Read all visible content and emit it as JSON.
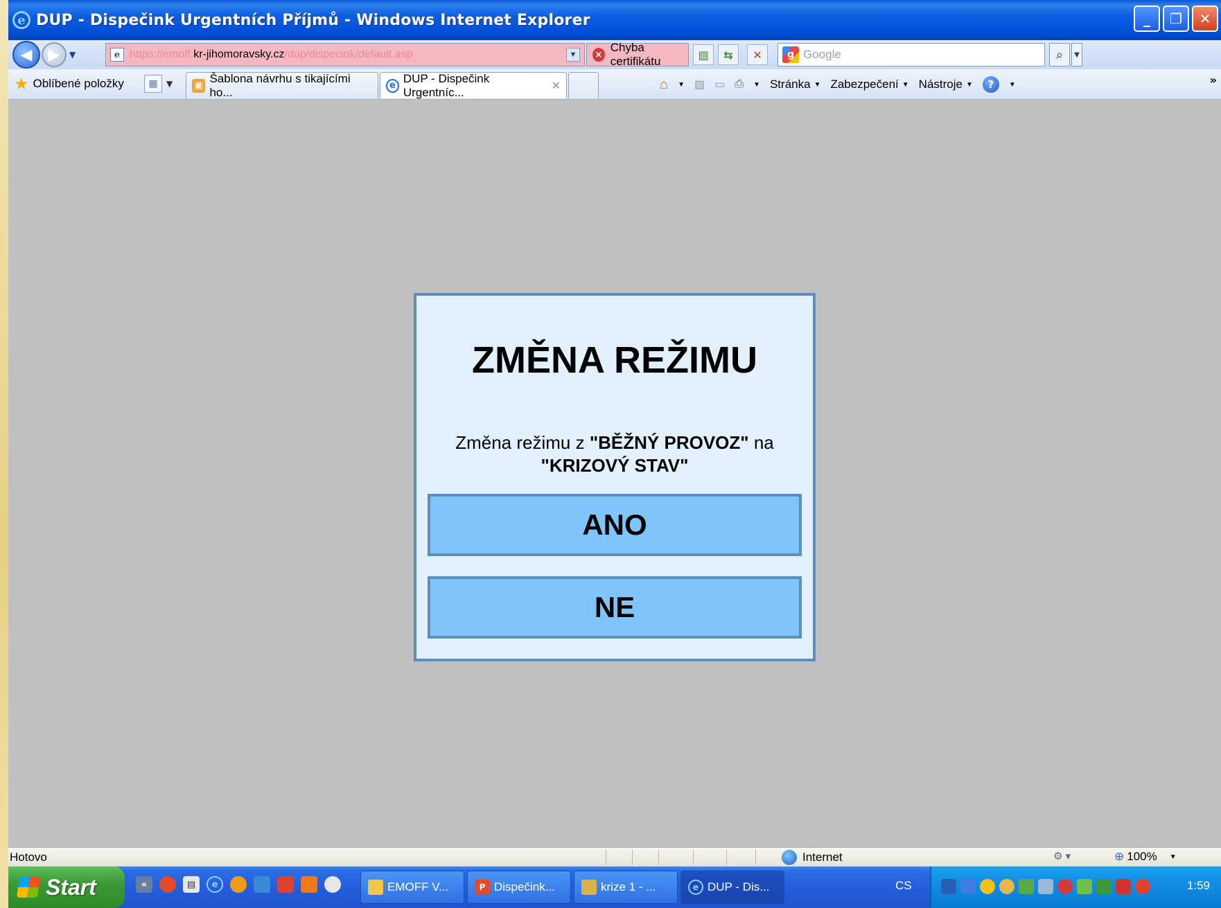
{
  "window": {
    "title": "DUP - Dispečink Urgentních Příjmů - Windows Internet Explorer",
    "controls": {
      "minimize": "_",
      "maximize": "❐",
      "close": "✕"
    }
  },
  "address_bar": {
    "url_prefix": "https://emoff.",
    "url_host": "kr-jihomoravsky.cz",
    "url_path": "/dup/dispecink/default.asp",
    "cert_error": "Chyba certifikátu",
    "search_placeholder": "Google",
    "search_engine_icon": "google-icon"
  },
  "toolbar": {
    "favorites_label": "Oblíbené položky",
    "tabs": [
      {
        "label": "Šablona návrhu s tikajícími ho...",
        "active": false
      },
      {
        "label": "DUP - Dispečink Urgentníc...",
        "active": true
      }
    ],
    "commands": [
      "Stránka",
      "Zabezpečení",
      "Nástroje"
    ]
  },
  "dialog": {
    "title": "ZMĚNA REŽIMU",
    "message_prefix": "Změna režimu z ",
    "from_state": "\"BĚŽNÝ PROVOZ\"",
    "message_mid": " na ",
    "to_state": "\"KRIZOVÝ STAV\"",
    "yes_label": "ANO",
    "no_label": "NE"
  },
  "status_bar": {
    "text": "Hotovo",
    "zone": "Internet",
    "zoom": "100%"
  },
  "taskbar": {
    "start_label": "Start",
    "buttons": [
      {
        "label": "EMOFF V...",
        "active": false
      },
      {
        "label": "Dispečink...",
        "active": false
      },
      {
        "label": "krize 1 - ...",
        "active": false
      },
      {
        "label": "DUP - Dis...",
        "active": true
      }
    ],
    "language": "CS",
    "clock": "1:59"
  },
  "colors": {
    "dialog_bg": "#e3f1ff",
    "dialog_border": "#5c8fbf",
    "button_bg": "#7fc4fb",
    "content_bg": "#c0c0c0",
    "cert_error_bg": "#f5b8c0"
  }
}
